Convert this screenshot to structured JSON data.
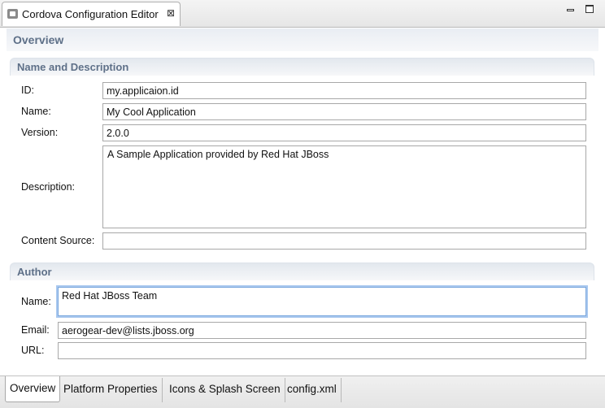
{
  "editor_tab": {
    "title": "Cordova Configuration Editor",
    "close_glyph": "⊠"
  },
  "icons": {
    "editor": "cordova-config-file-icon",
    "close": "close-icon",
    "minimize": "minimize-icon",
    "maximize": "maximize-icon"
  },
  "page": {
    "title": "Overview"
  },
  "name_description": {
    "heading": "Name and Description",
    "id_label": "ID:",
    "id_value": "my.applicaion.id",
    "name_label": "Name:",
    "name_value": "My Cool Application",
    "version_label": "Version:",
    "version_value": "2.0.0",
    "description_label": "Description:",
    "description_value": "A Sample Application provided by Red Hat JBoss",
    "content_source_label": "Content Source:",
    "content_source_value": ""
  },
  "author": {
    "heading": "Author",
    "name_label": "Name:",
    "name_value": "Red Hat JBoss Team",
    "email_label": "Email:",
    "email_value": "aerogear-dev@lists.jboss.org",
    "url_label": "URL:",
    "url_value": ""
  },
  "bottom_tabs": [
    {
      "label": "Overview",
      "active": true
    },
    {
      "label": "Platform Properties",
      "active": false
    },
    {
      "label": "Icons & Splash Screen",
      "active": false
    },
    {
      "label": "config.xml",
      "active": false
    }
  ],
  "colors": {
    "section_heading": "#5e7088",
    "focus_ring": "#a9c8ef"
  }
}
